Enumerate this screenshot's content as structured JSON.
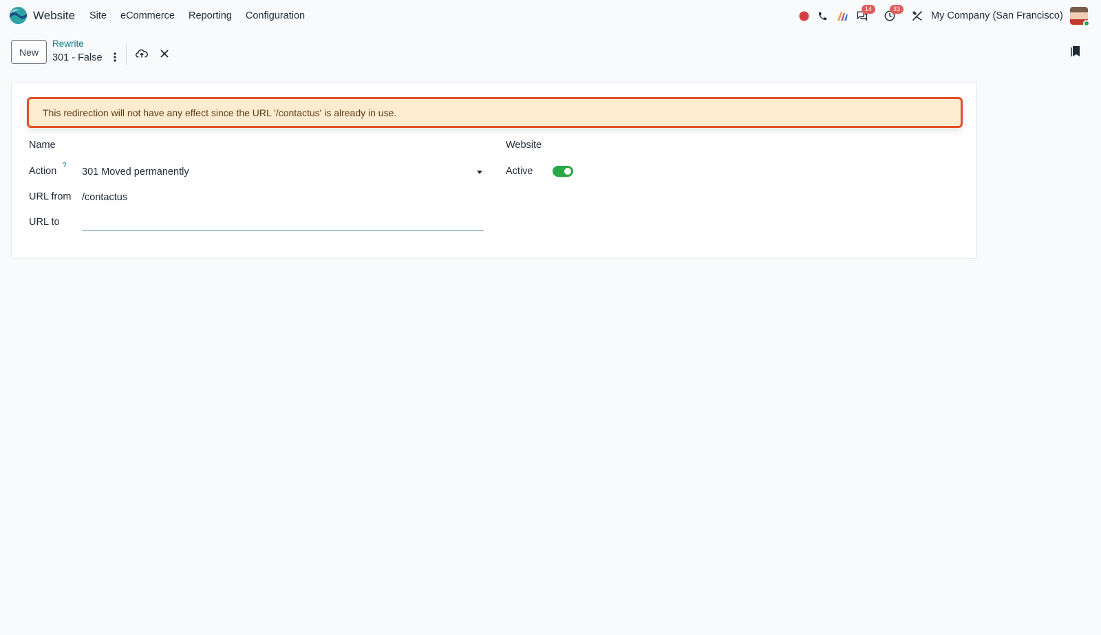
{
  "navbar": {
    "app_name": "Website",
    "menu": [
      "Site",
      "eCommerce",
      "Reporting",
      "Configuration"
    ],
    "badges": {
      "messages": "14",
      "activities": "33"
    },
    "company": "My Company (San Francisco)",
    "colors": {
      "badge": "#e35a5a",
      "record_dot": "#d43f3f"
    }
  },
  "control_panel": {
    "new_label": "New",
    "breadcrumb": "Rewrite",
    "record_title": "301 - False"
  },
  "form": {
    "alert": "This redirection will not have any effect since the URL '/contactus' is already in use.",
    "name_label": "Name",
    "action_label": "Action",
    "action_help": "?",
    "action_value": "301 Moved permanently",
    "url_from_label": "URL from",
    "url_from_value": "/contactus",
    "url_to_label": "URL to",
    "url_to_value": "",
    "website_label": "Website",
    "active_label": "Active",
    "active": true,
    "colors": {
      "alert_border": "#e2502c",
      "alert_bg": "#fdecd0",
      "toggle_on": "#28a745",
      "accent": "#0e7c86"
    }
  }
}
